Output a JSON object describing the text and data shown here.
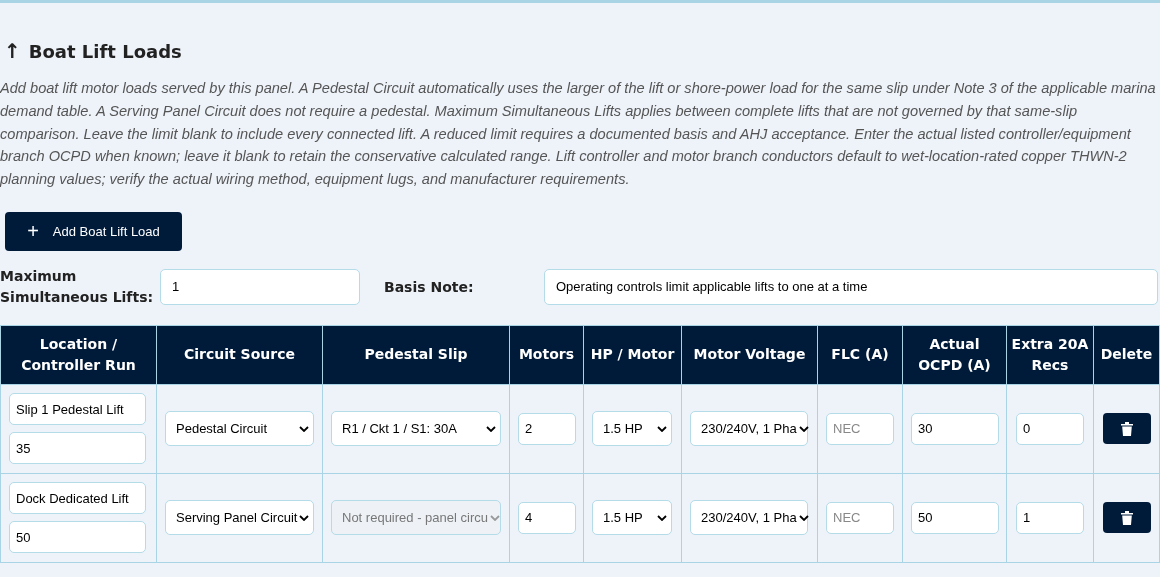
{
  "section": {
    "arrow": "↑",
    "title": "Boat Lift Loads",
    "description": "Add boat lift motor loads served by this panel. A Pedestal Circuit automatically uses the larger of the lift or shore-power load for the same slip under Note 3 of the applicable marina demand table. A Serving Panel Circuit does not require a pedestal. Maximum Simultaneous Lifts applies between complete lifts that are not governed by that same-slip comparison. Leave the limit blank to include every connected lift. A reduced limit requires a documented basis and AHJ acceptance. Enter the actual listed controller/equipment branch OCPD when known; leave it blank to retain the conservative calculated range. Lift controller and motor branch conductors default to wet-location-rated copper THWN-2 planning values; verify the actual wiring method, equipment lugs, and manufacturer requirements."
  },
  "add_button": {
    "icon": "+",
    "label": "Add Boat Lift Load"
  },
  "max_lifts": {
    "label": "Maximum Simultaneous Lifts:",
    "value": "1"
  },
  "basis_note": {
    "label": "Basis Note:",
    "value": "Operating controls limit applicable lifts to one at a time"
  },
  "table": {
    "columns": [
      "Location / Controller Run",
      "Circuit Source",
      "Pedestal Slip",
      "Motors",
      "HP / Motor",
      "Motor Voltage",
      "FLC (A)",
      "Actual OCPD (A)",
      "Extra 20A Recs",
      "Delete"
    ],
    "rows": [
      {
        "location": "Slip 1 Pedestal Lift",
        "run_length": "35",
        "circuit_source": "Pedestal Circuit",
        "pedestal_slip": {
          "value": "R1 / Ckt 1 / S1: 30A",
          "disabled": false
        },
        "motors": "2",
        "hp": "1.5 HP",
        "voltage": "230/240V, 1 Pha",
        "flc_placeholder": "NEC",
        "ocpd": "30",
        "extra_recs": "0"
      },
      {
        "location": "Dock Dedicated Lift",
        "run_length": "50",
        "circuit_source": "Serving Panel Circuit",
        "pedestal_slip": {
          "value": "Not required - panel circu",
          "disabled": true
        },
        "motors": "4",
        "hp": "1.5 HP",
        "voltage": "230/240V, 1 Pha",
        "flc_placeholder": "NEC",
        "ocpd": "50",
        "extra_recs": "1"
      }
    ]
  }
}
